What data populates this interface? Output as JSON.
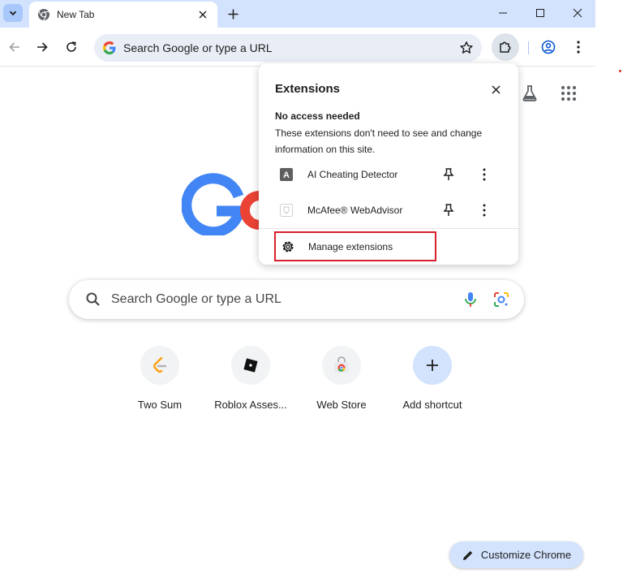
{
  "tab": {
    "title": "New Tab"
  },
  "omnibox": {
    "placeholder": "Search Google or type a URL"
  },
  "ntp": {
    "search_placeholder": "Search Google or type a URL",
    "shortcuts": [
      {
        "label": "Two Sum",
        "icon": "leetcode-icon"
      },
      {
        "label": "Roblox Asses...",
        "icon": "roblox-icon"
      },
      {
        "label": "Web Store",
        "icon": "chrome-web-store-icon"
      },
      {
        "label": "Add shortcut",
        "icon": "plus-icon"
      }
    ],
    "customize_label": "Customize Chrome"
  },
  "extensions_popup": {
    "title": "Extensions",
    "section_title": "No access needed",
    "section_desc": "These extensions don't need to see and change information on this site.",
    "items": [
      {
        "name": "AI Cheating Detector",
        "icon": "letter-a-icon"
      },
      {
        "name": "McAfee® WebAdvisor",
        "icon": "mcafee-icon"
      }
    ],
    "manage_label": "Manage extensions"
  },
  "colors": {
    "tabstrip": "#d3e3fd",
    "omnibox": "#e9eef6",
    "highlight_box": "#d6202b",
    "accent": "#0b57d0"
  }
}
